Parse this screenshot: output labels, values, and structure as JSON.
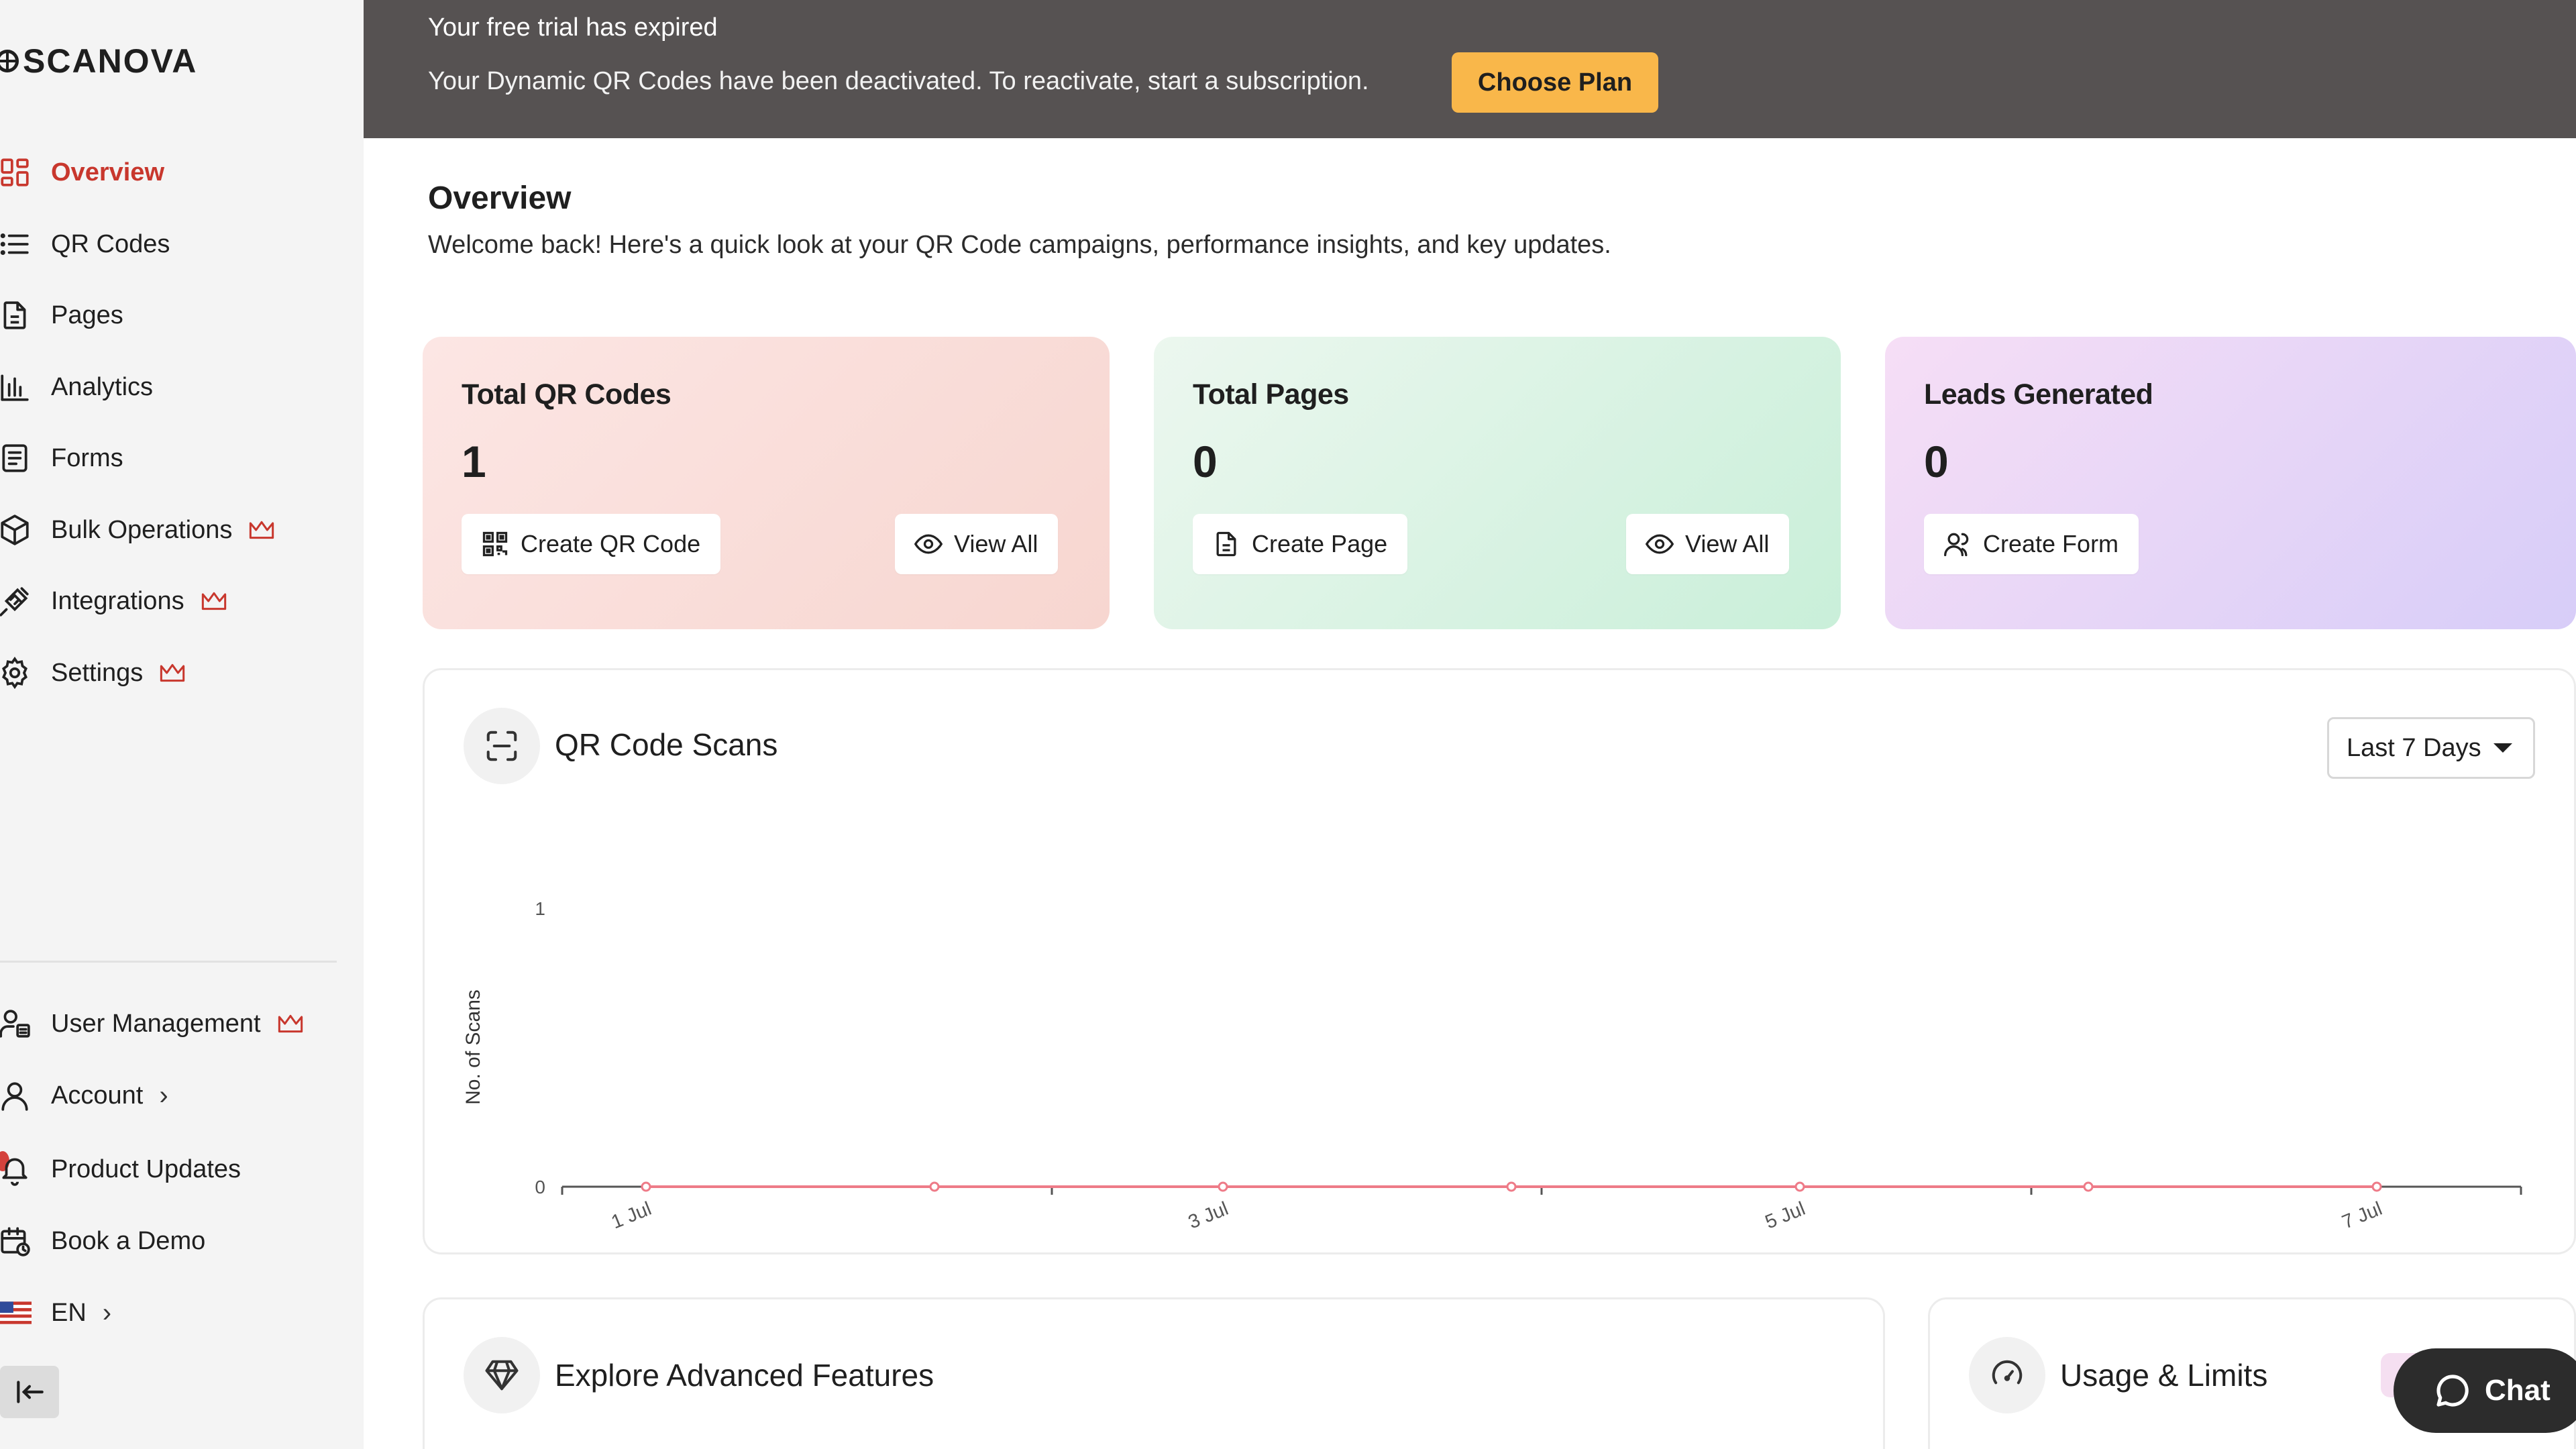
{
  "brand": {
    "name": "SCANOVA"
  },
  "banner": {
    "title": "Your free trial has expired",
    "message": "Your Dynamic QR Codes have been deactivated. To reactivate, start a subscription.",
    "cta": "Choose Plan",
    "bg_color": "#565252",
    "cta_color": "#f9b74a"
  },
  "sidebar": {
    "items": [
      {
        "label": "Overview",
        "icon": "grid-icon",
        "active": true
      },
      {
        "label": "QR Codes",
        "icon": "list-icon"
      },
      {
        "label": "Pages",
        "icon": "page-icon"
      },
      {
        "label": "Analytics",
        "icon": "bar-chart-icon"
      },
      {
        "label": "Forms",
        "icon": "form-icon"
      },
      {
        "label": "Bulk Operations",
        "icon": "box-icon",
        "premium": true
      },
      {
        "label": "Integrations",
        "icon": "plug-icon",
        "premium": true
      },
      {
        "label": "Settings",
        "icon": "gear-icon",
        "premium": true
      }
    ],
    "bottom_items": [
      {
        "label": "User Management",
        "icon": "users-icon",
        "premium": true
      },
      {
        "label": "Account",
        "icon": "user-icon",
        "chevron": true
      },
      {
        "label": "Product Updates",
        "icon": "bell-icon"
      },
      {
        "label": "Book a Demo",
        "icon": "calendar-icon"
      },
      {
        "label": "EN",
        "icon": "us-flag-icon",
        "chevron": true
      }
    ],
    "active_color": "#c8372d",
    "premium_color": "#c8372d"
  },
  "header": {
    "title": "Overview",
    "subtitle": "Welcome back! Here's a quick look at your QR Code campaigns, performance insights, and key updates."
  },
  "cards": [
    {
      "title": "Total QR Codes",
      "value": "1",
      "primary": "Create QR Code",
      "secondary": "View All"
    },
    {
      "title": "Total Pages",
      "value": "0",
      "primary": "Create Page",
      "secondary": "View All"
    },
    {
      "title": "Leads Generated",
      "value": "0",
      "primary": "Create Form"
    }
  ],
  "scans": {
    "title": "QR Code Scans",
    "range": "Last 7 Days"
  },
  "chart_data": {
    "type": "line",
    "x": [
      "1 Jul",
      "2 Jul",
      "3 Jul",
      "4 Jul",
      "5 Jul",
      "6 Jul",
      "7 Jul"
    ],
    "x_tick_labels": [
      "1 Jul",
      "3 Jul",
      "5 Jul",
      "7 Jul"
    ],
    "series": [
      {
        "values": [
          0,
          0,
          0,
          0,
          0,
          0,
          0
        ],
        "color": "#ee7b88"
      }
    ],
    "ylabel": "No. of Scans",
    "xlabel": "",
    "y_ticks": [
      "0",
      "1"
    ],
    "ylim": [
      0,
      1
    ],
    "grid": false
  },
  "features": {
    "title": "Explore Advanced Features"
  },
  "usage": {
    "title": "Usage & Limits"
  },
  "chat": {
    "label": "Chat"
  }
}
